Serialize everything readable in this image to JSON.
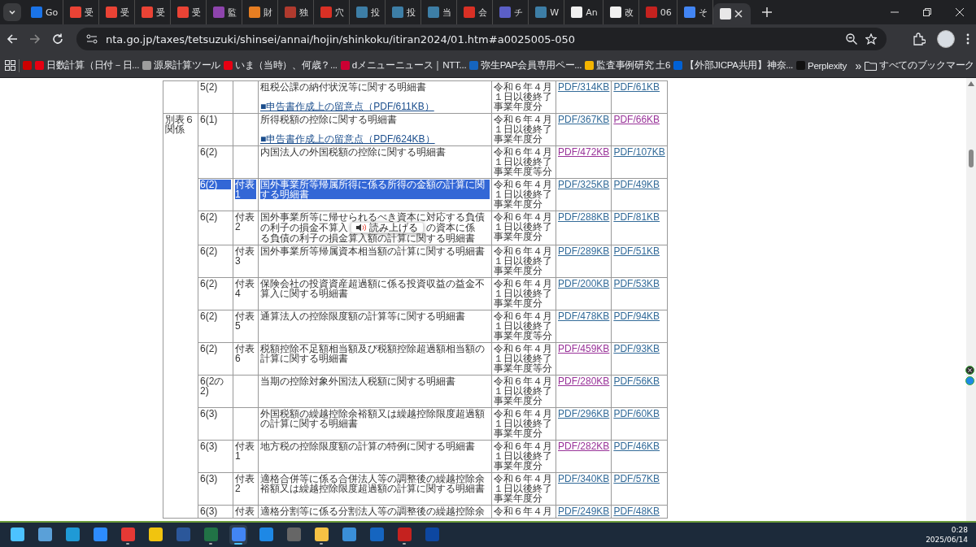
{
  "tabs": [
    {
      "title": "Go",
      "color": "#1a73e8",
      "selected": false
    },
    {
      "title": "受",
      "color": "#ea4335",
      "selected": false
    },
    {
      "title": "受",
      "color": "#ea4335",
      "selected": false
    },
    {
      "title": "受",
      "color": "#ea4335",
      "selected": false
    },
    {
      "title": "受",
      "color": "#ea4335",
      "selected": false
    },
    {
      "title": "監",
      "color": "#8e44ad",
      "selected": false
    },
    {
      "title": "財",
      "color": "#e67e22",
      "selected": false
    },
    {
      "title": "独",
      "color": "#b03a2e",
      "selected": false
    },
    {
      "title": "穴",
      "color": "#d93025",
      "selected": false
    },
    {
      "title": "投",
      "color": "#3d7ea6",
      "selected": false
    },
    {
      "title": "投",
      "color": "#3d7ea6",
      "selected": false
    },
    {
      "title": "当",
      "color": "#3d7ea6",
      "selected": false
    },
    {
      "title": "会",
      "color": "#d93025",
      "selected": false
    },
    {
      "title": "チ",
      "color": "#5b5fc7",
      "selected": false
    },
    {
      "title": "W",
      "color": "#3d7ea6",
      "selected": false
    },
    {
      "title": "An",
      "color": "#f0f0f0",
      "selected": false
    },
    {
      "title": "改",
      "color": "#f0f0f0",
      "selected": false
    },
    {
      "title": "06",
      "color": "#c5221f",
      "selected": false
    },
    {
      "title": "そ",
      "color": "#4285f4",
      "selected": false
    },
    {
      "color": "#e8e8e8",
      "selected": true
    }
  ],
  "address": "nta.go.jp/taxes/tetsuzuki/shinsei/annai/hojin/shinkoku/itiran2024/01.htm#a0025005-050",
  "bookmarks": [
    {
      "color": "#cc0000"
    },
    {
      "label": "日数計算（日付－日...",
      "color": "#e60012"
    },
    {
      "label": "源泉計算ツール",
      "color": "#9e9e9e"
    },
    {
      "label": "いま（当時）、何歳？...",
      "color": "#e60012"
    },
    {
      "label": "dメニューニュース｜NTT...",
      "color": "#cc0033"
    },
    {
      "label": "弥生PAP会員専用ペー...",
      "color": "#1565c0"
    },
    {
      "label": "監査事例研究 土6",
      "color": "#f4b400"
    },
    {
      "label": "【外部JICPA共用】神奈...",
      "color": "#0061d5"
    },
    {
      "label": "Perplexity",
      "color": "#111111"
    }
  ],
  "bookmarks_more": "»",
  "all_bookmarks": "すべてのブックマーク",
  "sections": [
    {
      "rows": [
        {
          "form": "5(2)",
          "name": "租税公課の納付状況等に関する明細書",
          "note": "■申告書作成上の留意点（PDF/611KB）",
          "period": "令和６年４月１日以後終了事業年度分",
          "pdf": {
            "text": "PDF/314KB",
            "visited": false
          },
          "alt": {
            "text": "PDF/61KB",
            "visited": false
          },
          "selected": false
        }
      ]
    },
    {
      "group": "別表６関係",
      "rows": [
        {
          "form": "6(1)",
          "name": "所得税額の控除に関する明細書",
          "note": "■申告書作成上の留意点（PDF/624KB）",
          "period": "令和６年４月１日以後終了事業年度分",
          "pdf": {
            "text": "PDF/367KB",
            "visited": false
          },
          "alt": {
            "text": "PDF/66KB",
            "visited": true
          },
          "selected": false
        },
        {
          "form": "6(2)",
          "name": "内国法人の外国税額の控除に関する明細書",
          "period": "令和６年４月１日以後終了事業年度等分",
          "pdf": {
            "text": "PDF/472KB",
            "visited": true
          },
          "alt": {
            "text": "PDF/107KB",
            "visited": false
          },
          "selected": false
        },
        {
          "form": "6(2)",
          "attachment": "付表1",
          "name": "国外事業所等帰属所得に係る所得の金額の計算に関する明細書",
          "period": "令和６年４月１日以後終了事業年度分",
          "pdf": {
            "text": "PDF/325KB",
            "visited": false
          },
          "alt": {
            "text": "PDF/49KB",
            "visited": false
          },
          "selected": true
        },
        {
          "form": "6(2)",
          "attachment": "付表2",
          "name_parts": [
            "国外事業所等に帰せられるべき資本に対応する負債",
            "の利子の損金不算入",
            "の資本に係",
            "る負債の利子の損金算入額の計算に関する明細書"
          ],
          "popup": "読み上げる",
          "period": "令和６年４月１日以後終了事業年度分",
          "pdf": {
            "text": "PDF/288KB",
            "visited": false
          },
          "alt": {
            "text": "PDF/81KB",
            "visited": false
          },
          "selected": false
        },
        {
          "form": "6(2)",
          "attachment": "付表3",
          "name": "国外事業所等帰属資本相当額の計算に関する明細書",
          "period": "令和６年４月１日以後終了事業年度分",
          "pdf": {
            "text": "PDF/289KB",
            "visited": false
          },
          "alt": {
            "text": "PDF/51KB",
            "visited": false
          },
          "selected": false
        },
        {
          "form": "6(2)",
          "attachment": "付表4",
          "name": "保険会社の投資資産超過額に係る投資収益の益金不算入に関する明細書",
          "period": "令和６年４月１日以後終了事業年度分",
          "pdf": {
            "text": "PDF/200KB",
            "visited": false
          },
          "alt": {
            "text": "PDF/53KB",
            "visited": false
          },
          "selected": false
        },
        {
          "form": "6(2)",
          "attachment": "付表5",
          "name": "通算法人の控除限度額の計算等に関する明細書",
          "period": "令和６年４月１日以後終了事業年度等分",
          "pdf": {
            "text": "PDF/478KB",
            "visited": false
          },
          "alt": {
            "text": "PDF/94KB",
            "visited": false
          },
          "selected": false
        },
        {
          "form": "6(2)",
          "attachment": "付表6",
          "name": "税額控除不足額相当額及び税額控除超過額相当額の計算に関する明細書",
          "period": "令和６年４月１日以後終了事業年度等分",
          "pdf": {
            "text": "PDF/459KB",
            "visited": true
          },
          "alt": {
            "text": "PDF/93KB",
            "visited": false
          },
          "selected": false
        },
        {
          "form": "6(2の2)",
          "name": "当期の控除対象外国法人税額に関する明細書",
          "period": "令和６年４月１日以後終了事業年度分",
          "pdf": {
            "text": "PDF/280KB",
            "visited": true
          },
          "alt": {
            "text": "PDF/56KB",
            "visited": false
          },
          "selected": false
        },
        {
          "form": "6(3)",
          "name": "外国税額の繰越控除余裕額又は繰越控除限度超過額の計算に関する明細書",
          "period": "令和６年４月１日以後終了事業年度分",
          "pdf": {
            "text": "PDF/296KB",
            "visited": false
          },
          "alt": {
            "text": "PDF/60KB",
            "visited": false
          },
          "selected": false
        },
        {
          "form": "6(3)",
          "attachment": "付表1",
          "name": "地方税の控除限度額の計算の特例に関する明細書",
          "period": "令和６年４月１日以後終了事業年度分",
          "pdf": {
            "text": "PDF/282KB",
            "visited": true
          },
          "alt": {
            "text": "PDF/46KB",
            "visited": false
          },
          "selected": false
        },
        {
          "form": "6(3)",
          "attachment": "付表2",
          "name": "適格合併等に係る合併法人等の調整後の繰越控除余裕額又は繰越控除限度超過額の計算に関する明細書",
          "period": "令和６年４月１日以後終了事業年度分",
          "pdf": {
            "text": "PDF/340KB",
            "visited": false
          },
          "alt": {
            "text": "PDF/57KB",
            "visited": false
          },
          "selected": false
        },
        {
          "form": "6(3)",
          "attachment": "付表",
          "name": "適格分割等に係る分割法人等の調整後の繰越控除余",
          "period": "令和６年４月",
          "pdf": {
            "text": "PDF/249KB",
            "visited": false
          },
          "alt": {
            "text": "PDF/48KB",
            "visited": false
          },
          "selected": false
        }
      ]
    }
  ],
  "taskbar": {
    "apps": [
      {
        "color": "#4cc2ff",
        "open": false,
        "selected": false
      },
      {
        "color": "#5aa0d8",
        "open": false,
        "selected": false
      },
      {
        "color": "#1f9ad6",
        "open": false,
        "selected": false
      },
      {
        "color": "#2d8cff",
        "open": false,
        "selected": false
      },
      {
        "color": "#e53935",
        "open": true,
        "selected": false
      },
      {
        "color": "#f1c40f",
        "open": false,
        "selected": false
      },
      {
        "color": "#2b579a",
        "open": false,
        "selected": false
      },
      {
        "color": "#217346",
        "open": true,
        "selected": false
      },
      {
        "color": "#4285f4",
        "open": true,
        "selected": true
      },
      {
        "color": "#1e88e5",
        "open": false,
        "selected": false
      },
      {
        "color": "#666666",
        "open": false,
        "selected": false
      },
      {
        "color": "#f6c244",
        "open": true,
        "selected": false
      },
      {
        "color": "#3a8fd8",
        "open": false,
        "selected": false
      },
      {
        "color": "#1565c0",
        "open": false,
        "selected": false
      },
      {
        "color": "#c5221f",
        "open": true,
        "selected": false
      },
      {
        "color": "#0d47a1",
        "open": false,
        "selected": false
      }
    ],
    "time": "0:28",
    "date": "2025/06/14"
  }
}
